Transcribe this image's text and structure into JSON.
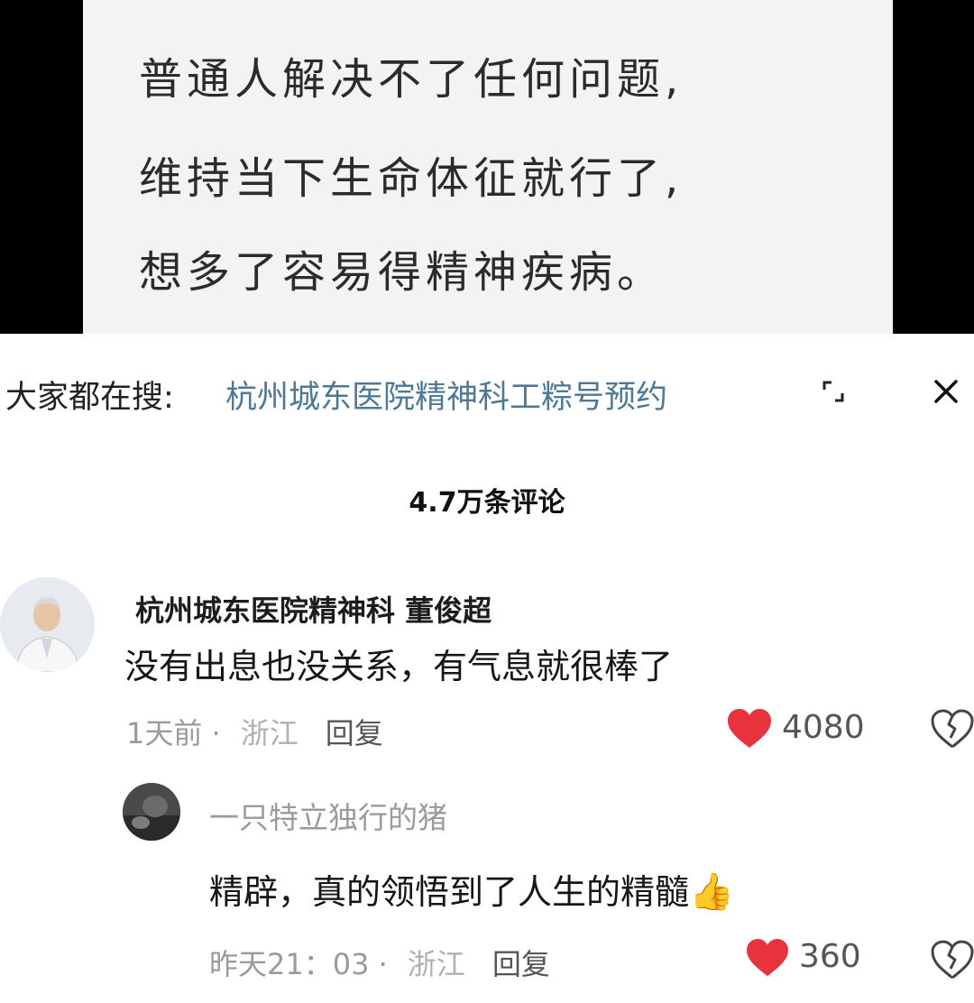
{
  "video": {
    "lines": [
      "普通人解决不了任何问题,",
      "维持当下生命体征就行了,",
      "想多了容易得精神疾病。"
    ]
  },
  "search": {
    "prefix": "大家都在搜:",
    "term": "杭州城东医院精神科工粽号预约"
  },
  "comments_header": "4.7万条评论",
  "comments": [
    {
      "username": "杭州城东医院精神科  董俊超",
      "text": "没有出息也没关系，有气息就很棒了",
      "time": "1天前",
      "location": "浙江",
      "reply_label": "回复",
      "likes": "4080"
    }
  ],
  "reply": {
    "username": "一只特立独行的猪",
    "text": "精辟，真的领悟到了人生的精髓",
    "emoji": "👍",
    "time": "昨天21：03",
    "location": "浙江",
    "reply_label": "回复",
    "likes": "360"
  },
  "colors": {
    "heart": "#e8323c",
    "link": "#4d7896",
    "meta": "#9a9a9a"
  },
  "icons": [
    "expand-icon",
    "close-icon",
    "heart-icon",
    "broken-heart-icon",
    "thumbs-up-icon"
  ]
}
